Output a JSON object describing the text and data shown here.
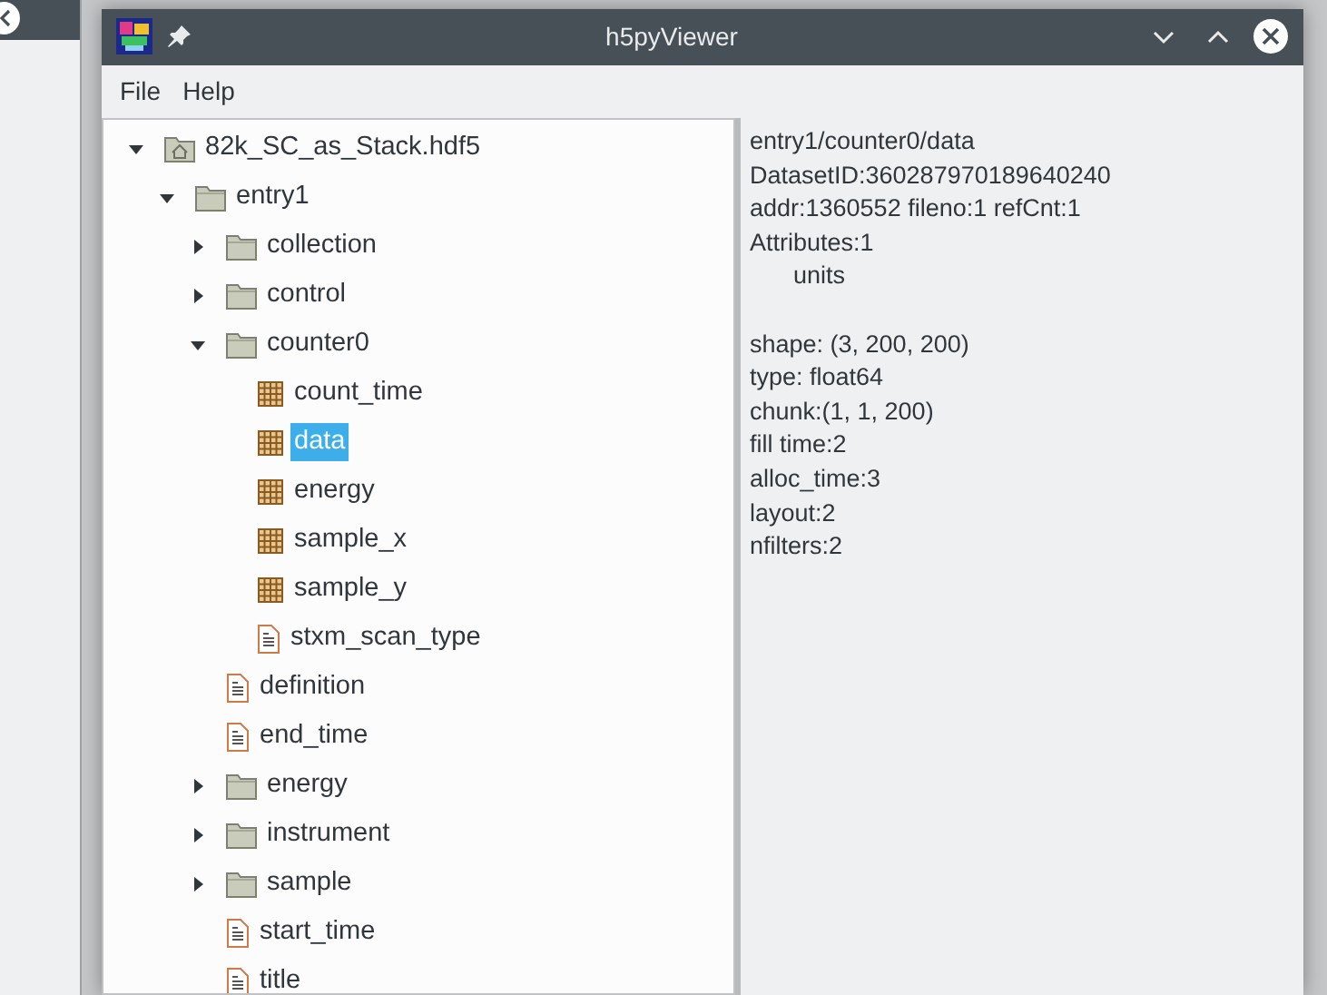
{
  "window": {
    "title": "h5pyViewer"
  },
  "menu": [
    "File",
    "Help"
  ],
  "tree": [
    {
      "label": "82k_SC_as_Stack.hdf5",
      "kind": "file",
      "expanded": true,
      "selected": false,
      "children": [
        {
          "label": "entry1",
          "kind": "group",
          "expanded": true,
          "selected": false,
          "children": [
            {
              "label": "collection",
              "kind": "group",
              "expanded": false,
              "selected": false
            },
            {
              "label": "control",
              "kind": "group",
              "expanded": false,
              "selected": false
            },
            {
              "label": "counter0",
              "kind": "group",
              "expanded": true,
              "selected": false,
              "children": [
                {
                  "label": "count_time",
                  "kind": "dataset",
                  "selected": false
                },
                {
                  "label": "data",
                  "kind": "dataset",
                  "selected": true
                },
                {
                  "label": "energy",
                  "kind": "dataset",
                  "selected": false
                },
                {
                  "label": "sample_x",
                  "kind": "dataset",
                  "selected": false
                },
                {
                  "label": "sample_y",
                  "kind": "dataset",
                  "selected": false
                },
                {
                  "label": "stxm_scan_type",
                  "kind": "text",
                  "selected": false
                }
              ]
            },
            {
              "label": "definition",
              "kind": "text",
              "selected": false
            },
            {
              "label": "end_time",
              "kind": "text",
              "selected": false
            },
            {
              "label": "energy",
              "kind": "group",
              "expanded": false,
              "selected": false
            },
            {
              "label": "instrument",
              "kind": "group",
              "expanded": false,
              "selected": false
            },
            {
              "label": "sample",
              "kind": "group",
              "expanded": false,
              "selected": false
            },
            {
              "label": "start_time",
              "kind": "text",
              "selected": false
            },
            {
              "label": "title",
              "kind": "text",
              "selected": false
            }
          ]
        }
      ]
    }
  ],
  "details": {
    "header": [
      "entry1/counter0/data",
      "DatasetID:360287970189640240",
      "addr:1360552 fileno:1 refCnt:1"
    ],
    "attributes": {
      "label": "Attributes:1",
      "names": [
        "units"
      ]
    },
    "properties": [
      "shape: (3, 200, 200)",
      "type: float64",
      "chunk:(1, 1, 200)",
      "fill time:2",
      "alloc_time:3",
      "layout:2",
      "nfilters:2"
    ]
  }
}
